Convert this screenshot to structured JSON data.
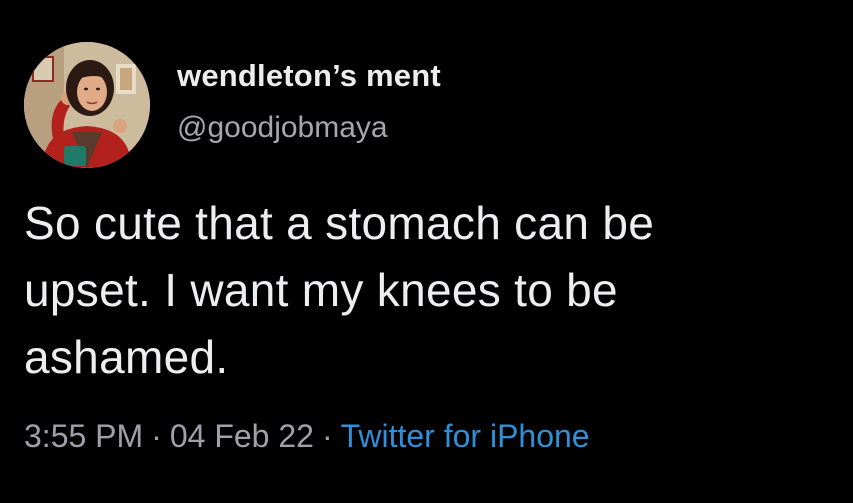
{
  "author": {
    "display_name": "wendleton’s ment",
    "handle": "@goodjobmaya"
  },
  "tweet": {
    "text_lines": [
      "So cute that a stomach can be",
      "upset. I want my knees to be",
      "ashamed."
    ]
  },
  "meta": {
    "time": "3:55 PM",
    "separator": "·",
    "date": "04 Feb 22",
    "source": "Twitter for iPhone"
  },
  "colors": {
    "background": "#000000",
    "text": "#e7e9ea",
    "secondary": "#9ea2a7",
    "link": "#2f8fd8"
  }
}
